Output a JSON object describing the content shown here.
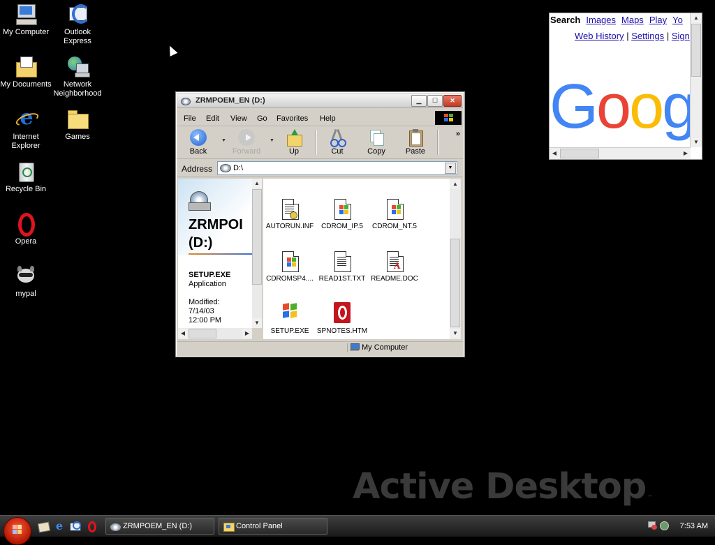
{
  "desktop": {
    "icons": [
      {
        "label": "My Computer",
        "icon": "computer-icon"
      },
      {
        "label": "Outlook Express",
        "icon": "outlook-express-icon"
      },
      {
        "label": "My Documents",
        "icon": "documents-folder-icon"
      },
      {
        "label": "Network Neighborhood",
        "icon": "network-icon"
      },
      {
        "label": "Internet Explorer",
        "icon": "internet-explorer-icon"
      },
      {
        "label": "Games",
        "icon": "folder-icon"
      },
      {
        "label": "Recycle Bin",
        "icon": "recycle-bin-icon"
      },
      {
        "label": "Opera",
        "icon": "opera-icon"
      },
      {
        "label": "mypal",
        "icon": "mypal-icon"
      }
    ],
    "watermark": "Active Desktop",
    "watermark_mark": "™"
  },
  "google_widget": {
    "nav_bold": "Search",
    "nav_links": [
      "Images",
      "Maps",
      "Play",
      "Yo"
    ],
    "nav2_links": [
      "Web History",
      "Settings",
      "Sign"
    ],
    "nav2_sep": "|",
    "logo_letters": [
      "G",
      "o",
      "o",
      "g"
    ],
    "logo_colors": [
      "#4285F4",
      "#EA4335",
      "#FBBC05",
      "#4285F4"
    ]
  },
  "explorer": {
    "title": "ZRMPOEM_EN (D:)",
    "menu": [
      "File",
      "Edit",
      "View",
      "Go",
      "Favorites",
      "Help"
    ],
    "toolbar": {
      "back": "Back",
      "forward": "Forward",
      "up": "Up",
      "cut": "Cut",
      "copy": "Copy",
      "paste": "Paste",
      "more": "»"
    },
    "address_label": "Address",
    "address_value": "D:\\",
    "left_pane": {
      "drive_title_1": "ZRMPOI",
      "drive_title_2": "(D:)",
      "selected_name": "SETUP.EXE",
      "selected_type": "Application",
      "modified_label": "Modified:",
      "modified_date": "7/14/03",
      "modified_time": "12:00 PM"
    },
    "files": [
      {
        "name": "AUTORUN.INF",
        "icon": "inf-file-icon"
      },
      {
        "name": "CDROM_IP.5",
        "icon": "windows-file-icon"
      },
      {
        "name": "CDROM_NT.5",
        "icon": "windows-file-icon"
      },
      {
        "name": "CDROMSP4....",
        "icon": "windows-file-icon"
      },
      {
        "name": "READ1ST.TXT",
        "icon": "text-file-icon"
      },
      {
        "name": "README.DOC",
        "icon": "word-doc-icon"
      },
      {
        "name": "SETUP.EXE",
        "icon": "setup-exe-icon"
      },
      {
        "name": "SPNOTES.HTM",
        "icon": "opera-html-icon"
      }
    ],
    "status_location": "My Computer"
  },
  "taskbar": {
    "tasks": [
      "ZRMPOEM_EN (D:)",
      "Control Panel"
    ],
    "clock": "7:53 AM"
  }
}
